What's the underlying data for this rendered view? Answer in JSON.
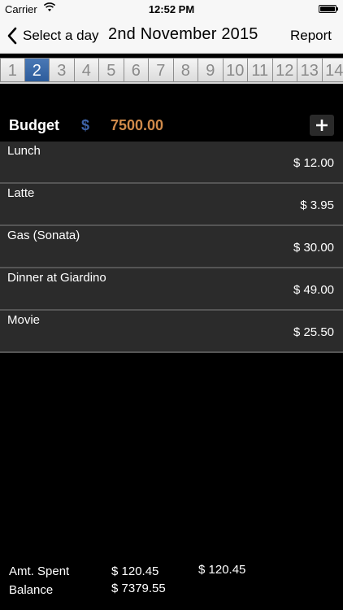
{
  "status_bar": {
    "carrier": "Carrier",
    "time": "12:52 PM"
  },
  "nav": {
    "back_label": "Select a day",
    "title": "2nd November 2015",
    "report_label": "Report"
  },
  "days": {
    "items": [
      "1",
      "2",
      "3",
      "4",
      "5",
      "6",
      "7",
      "8",
      "9",
      "10",
      "11",
      "12",
      "13",
      "14"
    ],
    "selected": "2"
  },
  "budget": {
    "label": "Budget",
    "currency": "$",
    "amount": "7500.00",
    "add_label": "+"
  },
  "expenses": [
    {
      "name": "Lunch",
      "amount": "$ 12.00"
    },
    {
      "name": "Latte",
      "amount": "$ 3.95"
    },
    {
      "name": "Gas (Sonata)",
      "amount": "$ 30.00"
    },
    {
      "name": "Dinner at Giardino",
      "amount": "$ 49.00"
    },
    {
      "name": "Movie",
      "amount": "$ 25.50"
    }
  ],
  "summary": {
    "spent_label": "Amt. Spent",
    "spent_value": "$ 120.45",
    "spent_value_2": "$ 120.45",
    "balance_label": "Balance",
    "balance_value": "$ 7379.55"
  },
  "colors": {
    "selected_day": "#2d5d9c",
    "budget_dollar": "#3e63a8",
    "budget_amount": "#d08a4a"
  }
}
